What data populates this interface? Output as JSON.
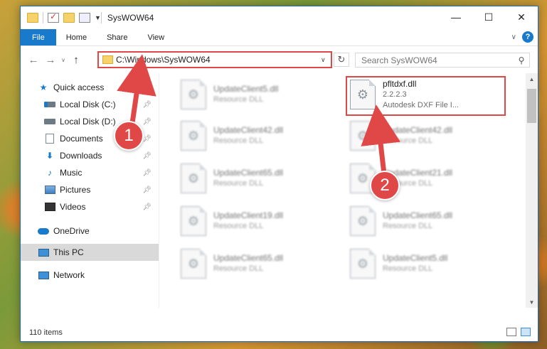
{
  "window": {
    "title": "SysWOW64",
    "controls": [
      "—",
      "☐",
      "✕"
    ]
  },
  "ribbon": {
    "tabs": [
      "File",
      "Home",
      "Share",
      "View"
    ],
    "help": "?"
  },
  "address": {
    "path": "C:\\Windows\\SysWOW64",
    "search_placeholder": "Search SysWOW64"
  },
  "sidebar": {
    "quick_access": "Quick access",
    "pinned": [
      {
        "label": "Local Disk (C:)",
        "icon": "drive-c-icon"
      },
      {
        "label": "Local Disk (D:)",
        "icon": "drive-icon"
      },
      {
        "label": "Documents",
        "icon": "documents-icon"
      },
      {
        "label": "Downloads",
        "icon": "download-icon"
      },
      {
        "label": "Music",
        "icon": "music-icon"
      },
      {
        "label": "Pictures",
        "icon": "pictures-icon"
      },
      {
        "label": "Videos",
        "icon": "videos-icon"
      }
    ],
    "onedrive": "OneDrive",
    "this_pc": "This PC",
    "network": "Network"
  },
  "files": [
    {
      "name": "UpdateClient5.dll",
      "desc": "Resource DLL"
    },
    {
      "name": "pfltdxf.dll",
      "version": "2.2.2.3",
      "desc": "Autodesk DXF File I..."
    },
    {
      "name": "UpdateClient42.dll",
      "desc": "Resource DLL"
    },
    {
      "name": "UpdateClient42.dll",
      "desc": "Resource DLL"
    },
    {
      "name": "UpdateClient65.dll",
      "desc": "Resource DLL"
    },
    {
      "name": "UpdateClient21.dll",
      "desc": "Resource DLL"
    },
    {
      "name": "UpdateClient19.dll",
      "desc": "Resource DLL"
    },
    {
      "name": "UpdateClient65.dll",
      "desc": "Resource DLL"
    },
    {
      "name": "UpdateClient65.dll",
      "desc": "Resource DLL"
    },
    {
      "name": "UpdateClient5.dll",
      "desc": "Resource DLL"
    }
  ],
  "status": {
    "item_count": "110 items"
  },
  "annotations": {
    "step1": "1",
    "step2": "2",
    "color": "#e04848"
  }
}
